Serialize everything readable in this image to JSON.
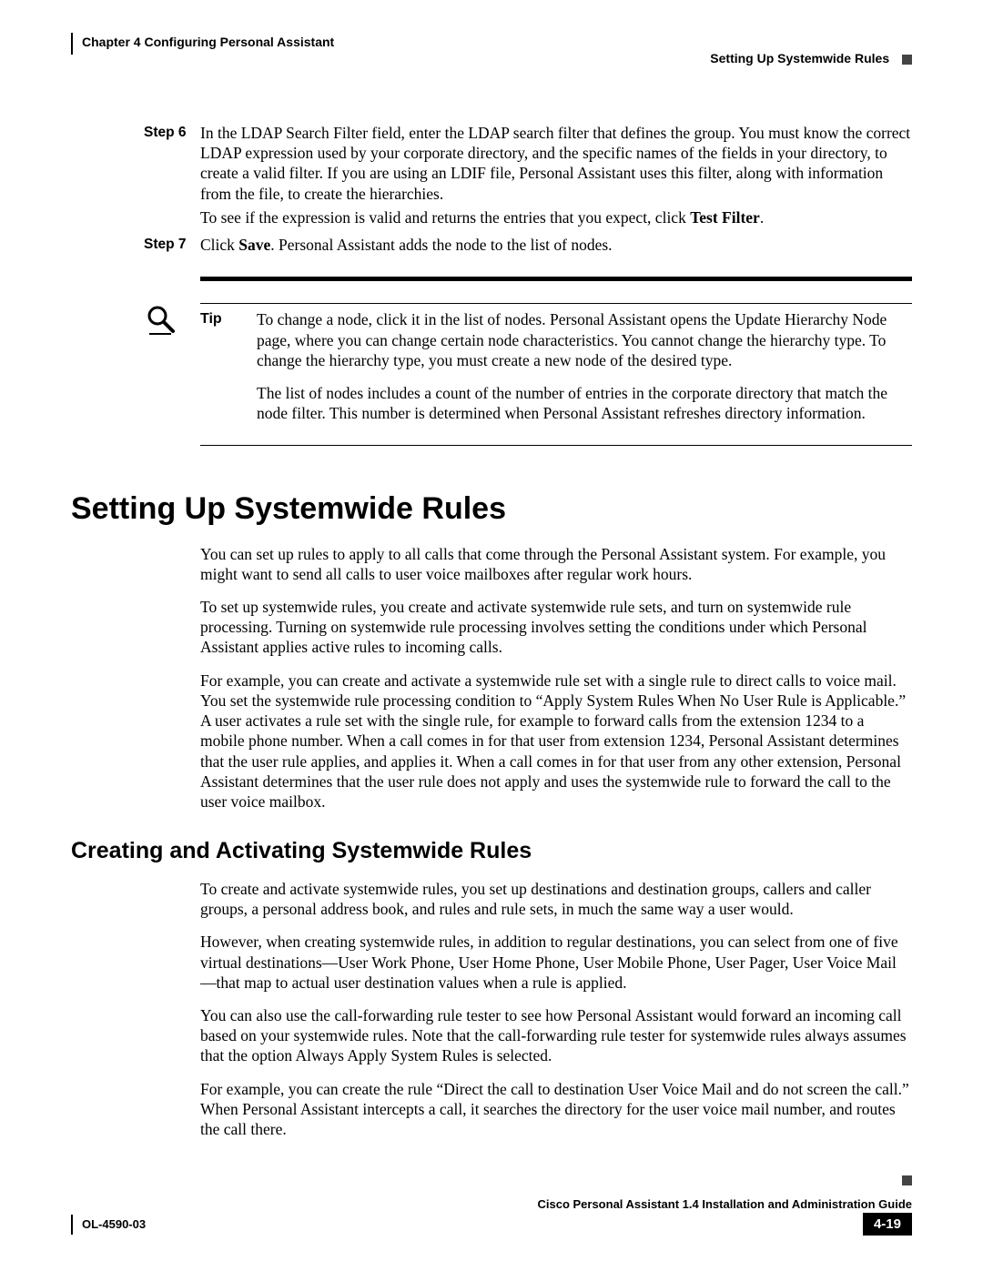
{
  "header": {
    "chapter": "Chapter 4    Configuring Personal Assistant",
    "section": "Setting Up Systemwide Rules"
  },
  "steps": {
    "s6_label": "Step 6",
    "s6_p1a": "In the LDAP Search Filter field, enter the LDAP search filter that defines the group. You must know the correct LDAP expression used by your corporate directory, and the specific names of the fields in your directory, to create a valid filter. If you are using an LDIF file, Personal Assistant uses this filter, along with information from the file, to create the hierarchies.",
    "s6_p2_pre": "To see if the expression is valid and returns the entries that you expect, click ",
    "s6_p2_bold": "Test Filter",
    "s6_p2_post": ".",
    "s7_label": "Step 7",
    "s7_pre": "Click ",
    "s7_bold": "Save",
    "s7_post": ". Personal Assistant adds the node to the list of nodes."
  },
  "tip": {
    "label": "Tip",
    "p1": "To change a node, click it in the list of nodes. Personal Assistant opens the Update Hierarchy Node page, where you can change certain node characteristics. You cannot change the hierarchy type. To change the hierarchy type, you must create a new node of the desired type.",
    "p2": "The list of nodes includes a count of the number of entries in the corporate directory that match the node filter. This number is determined when Personal Assistant refreshes directory information."
  },
  "h1": "Setting Up Systemwide Rules",
  "sec1": {
    "p1": "You can set up rules to apply to all calls that come through the Personal Assistant system. For example, you might want to send all calls to user voice mailboxes after regular work hours.",
    "p2": "To set up systemwide rules, you create and activate systemwide rule sets, and turn on systemwide rule processing. Turning on systemwide rule processing involves setting the conditions under which Personal Assistant applies active rules to incoming calls.",
    "p3": "For example, you can create and activate a systemwide rule set with a single rule to direct calls to voice mail. You set the systemwide rule processing condition to “Apply System Rules When No User Rule is Applicable.” A user activates a rule set with the single rule, for example to forward calls from the extension 1234 to a mobile phone number. When a call comes in for that user from extension 1234, Personal Assistant determines that the user rule applies, and applies it. When a call comes in for that user from any other extension, Personal Assistant determines that the user rule does not apply and uses the systemwide rule to forward the call to the user voice mailbox."
  },
  "h2": "Creating and Activating Systemwide Rules",
  "sec2": {
    "p1": "To create and activate systemwide rules, you set up destinations and destination groups, callers and caller groups, a personal address book, and rules and rule sets, in much the same way a user would.",
    "p2": "However, when creating systemwide rules, in addition to regular destinations, you can select from one of five virtual destinations—User Work Phone, User Home Phone, User Mobile Phone, User Pager, User Voice Mail—that map to actual user destination values when a rule is applied.",
    "p3": "You can also use the call-forwarding rule tester to see how Personal Assistant would forward an incoming call based on your systemwide rules. Note that the call-forwarding rule tester for systemwide rules always assumes that the option Always Apply System Rules is selected.",
    "p4": "For example, you can create the rule “Direct the call to destination User Voice Mail and do not screen the call.” When Personal Assistant intercepts a call, it searches the directory for the user voice mail number, and routes the call there."
  },
  "footer": {
    "title": "Cisco Personal Assistant 1.4 Installation and Administration Guide",
    "docid": "OL-4590-03",
    "page": "4-19"
  }
}
